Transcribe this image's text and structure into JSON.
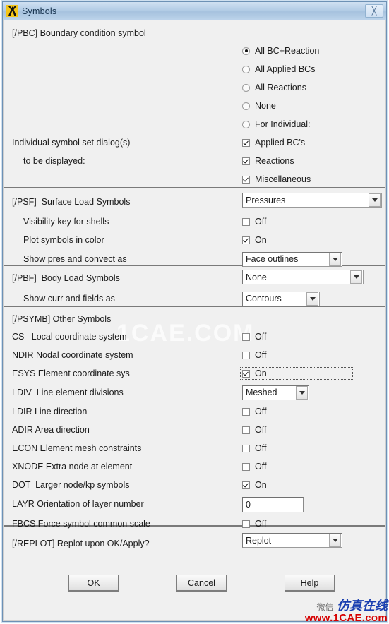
{
  "window": {
    "title": "Symbols",
    "logo_icon": "ansys-logo-icon",
    "close_icon": "close-icon",
    "close_label": "╳"
  },
  "colors": {
    "titlebar": "#a6c2de",
    "client_bg": "#f0f0f0",
    "border": "#6d91b5",
    "divider": "#7a7a7a",
    "watermark_url": "#d60000",
    "watermark_cn": "#1a3fb0"
  },
  "sections": {
    "pbc": {
      "heading": "[/PBC] Boundary condition symbol",
      "label_dialogs": "Individual symbol set dialog(s)",
      "label_displayed": "to be displayed:",
      "radios": [
        {
          "label": "All BC+Reaction",
          "selected": true
        },
        {
          "label": "All Applied BCs",
          "selected": false
        },
        {
          "label": "All Reactions",
          "selected": false
        },
        {
          "label": "None",
          "selected": false
        },
        {
          "label": "For Individual:",
          "selected": false
        }
      ],
      "checks": [
        {
          "label": "Applied BC's",
          "checked": true
        },
        {
          "label": "Reactions",
          "checked": true
        },
        {
          "label": "Miscellaneous",
          "checked": true
        }
      ]
    },
    "psf": {
      "heading": "[/PSF]  Surface Load Symbols",
      "heading_value": "Pressures",
      "rows": [
        {
          "label": "Visibility key for shells",
          "type": "checkbox",
          "value": "Off",
          "checked": false
        },
        {
          "label": "Plot symbols in color",
          "type": "checkbox",
          "value": "On",
          "checked": true
        },
        {
          "label": "Show pres and convect as",
          "type": "dropdown",
          "value": "Face outlines"
        }
      ]
    },
    "pbf": {
      "heading": "[/PBF]  Body Load Symbols",
      "heading_value": "None",
      "rows": [
        {
          "label": "Show curr and fields as",
          "type": "dropdown",
          "value": "Contours"
        }
      ]
    },
    "psymb": {
      "heading": "[/PSYMB] Other Symbols",
      "rows": [
        {
          "label": "CS   Local coordinate system",
          "type": "checkbox",
          "value": "Off",
          "checked": false,
          "focused": false
        },
        {
          "label": "NDIR Nodal coordinate system",
          "type": "checkbox",
          "value": "Off",
          "checked": false,
          "focused": false
        },
        {
          "label": "ESYS Element coordinate sys",
          "type": "checkbox",
          "value": "On",
          "checked": true,
          "focused": true
        },
        {
          "label": "LDIV  Line element divisions",
          "type": "dropdown",
          "value": "Meshed"
        },
        {
          "label": "LDIR Line direction",
          "type": "checkbox",
          "value": "Off",
          "checked": false,
          "focused": false
        },
        {
          "label": "ADIR Area direction",
          "type": "checkbox",
          "value": "Off",
          "checked": false,
          "focused": false
        },
        {
          "label": "ECON Element mesh constraints",
          "type": "checkbox",
          "value": "Off",
          "checked": false,
          "focused": false
        },
        {
          "label": "XNODE Extra node at element",
          "type": "checkbox",
          "value": "Off",
          "checked": false,
          "focused": false
        },
        {
          "label": "DOT  Larger node/kp symbols",
          "type": "checkbox",
          "value": "On",
          "checked": true,
          "focused": false
        },
        {
          "label": "LAYR Orientation of layer number",
          "type": "textinput",
          "value": "0"
        },
        {
          "label": "FBCS Force symbol common scale",
          "type": "checkbox",
          "value": "Off",
          "checked": false,
          "focused": false
        }
      ]
    },
    "replot": {
      "heading": "[/REPLOT] Replot upon OK/Apply?",
      "value": "Replot"
    }
  },
  "buttons": {
    "ok": "OK",
    "cancel": "Cancel",
    "help": "Help"
  },
  "watermarks": {
    "center": "1CAE.COM",
    "corner_cn_prefix": "微信",
    "corner_cn": "仿真在线",
    "corner_url": "www.1CAE.com"
  }
}
